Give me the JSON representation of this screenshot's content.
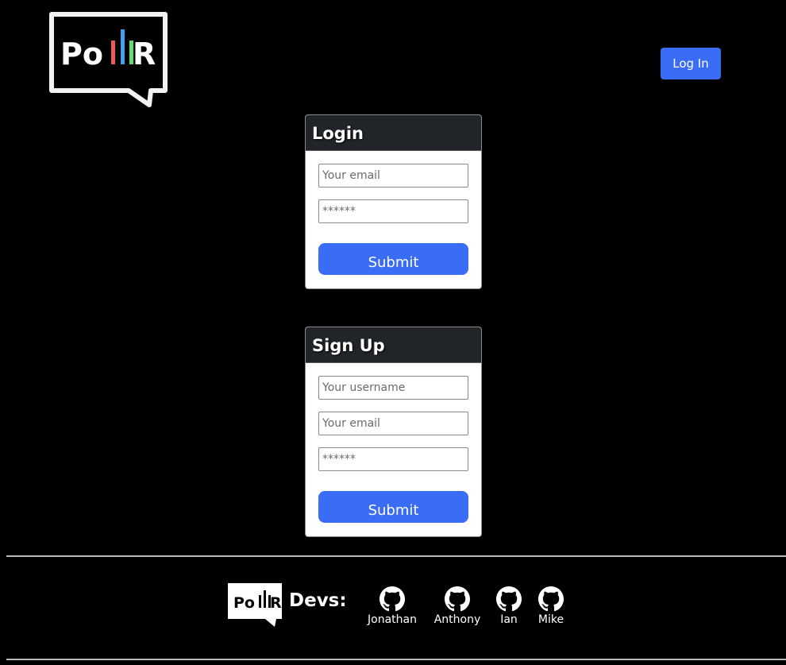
{
  "header": {
    "logo_text": "PollR",
    "login_button": "Log In"
  },
  "login_card": {
    "title": "Login",
    "email_placeholder": "Your email",
    "password_placeholder": "******",
    "submit": "Submit"
  },
  "signup_card": {
    "title": "Sign Up",
    "username_placeholder": "Your username",
    "email_placeholder": "Your email",
    "password_placeholder": "******",
    "submit": "Submit"
  },
  "footer": {
    "logo_text": "PollR",
    "devs_label": "Devs:",
    "devs": [
      {
        "name": "Jonathan",
        "icon": "github-icon"
      },
      {
        "name": "Anthony",
        "icon": "github-icon"
      },
      {
        "name": "Ian",
        "icon": "github-icon"
      },
      {
        "name": "Mike",
        "icon": "github-icon"
      }
    ]
  },
  "colors": {
    "accent_blue": "#3b6cf6",
    "card_header": "#212529",
    "logo_bar_red": "#f05a5a",
    "logo_bar_blue": "#3fa0f0",
    "logo_bar_green": "#5fe06e"
  }
}
